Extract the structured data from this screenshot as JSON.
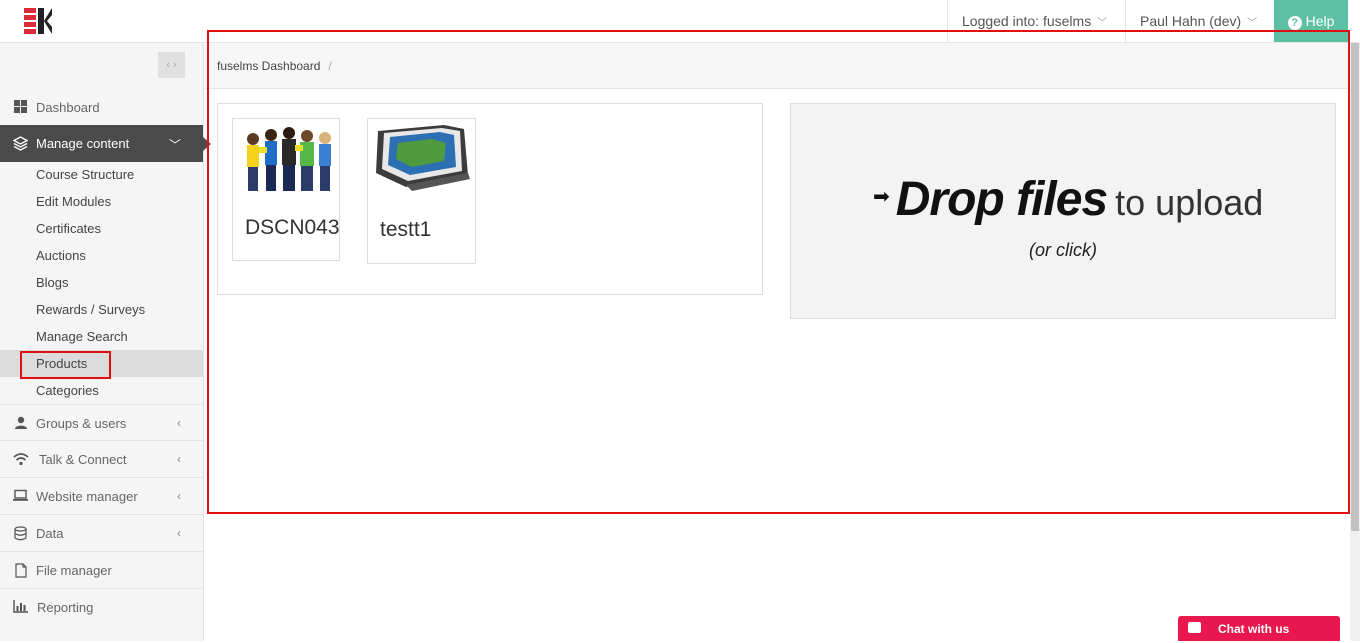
{
  "header": {
    "logged_into": "Logged into: fuselms",
    "user": "Paul Hahn (dev)",
    "help_label": "Help"
  },
  "sidebar": {
    "collapse_label": "‹ ›",
    "items": [
      {
        "label": "Dashboard",
        "icon": "dashboard-icon"
      },
      {
        "label": "Manage content",
        "icon": "layers-icon",
        "active": true
      },
      {
        "label": "Groups & users",
        "icon": "user-icon"
      },
      {
        "label": "Talk & Connect",
        "icon": "wifi-icon"
      },
      {
        "label": "Website manager",
        "icon": "laptop-icon"
      },
      {
        "label": "Data",
        "icon": "database-icon"
      },
      {
        "label": "File manager",
        "icon": "file-icon"
      },
      {
        "label": "Reporting",
        "icon": "bar-chart-icon"
      }
    ],
    "subitems": [
      {
        "label": "Course Structure"
      },
      {
        "label": "Edit Modules"
      },
      {
        "label": "Certificates"
      },
      {
        "label": "Auctions"
      },
      {
        "label": "Blogs"
      },
      {
        "label": "Rewards / Surveys"
      },
      {
        "label": "Manage Search"
      },
      {
        "label": "Products",
        "selected": true
      },
      {
        "label": "Categories"
      }
    ]
  },
  "breadcrumb": {
    "current": "fuselms Dashboard",
    "separator": "/"
  },
  "tiles": [
    {
      "label": "DSCN043"
    },
    {
      "label": "testt1"
    }
  ],
  "dropzone": {
    "bold": "Drop files",
    "light": "to upload",
    "sub": "(or click)"
  },
  "chat": {
    "label": "Chat with us"
  },
  "colors": {
    "accent": "#5dc0a4",
    "sidebar_active": "#4b4b4b",
    "chat": "#e8174d",
    "highlight": "#e01010"
  }
}
